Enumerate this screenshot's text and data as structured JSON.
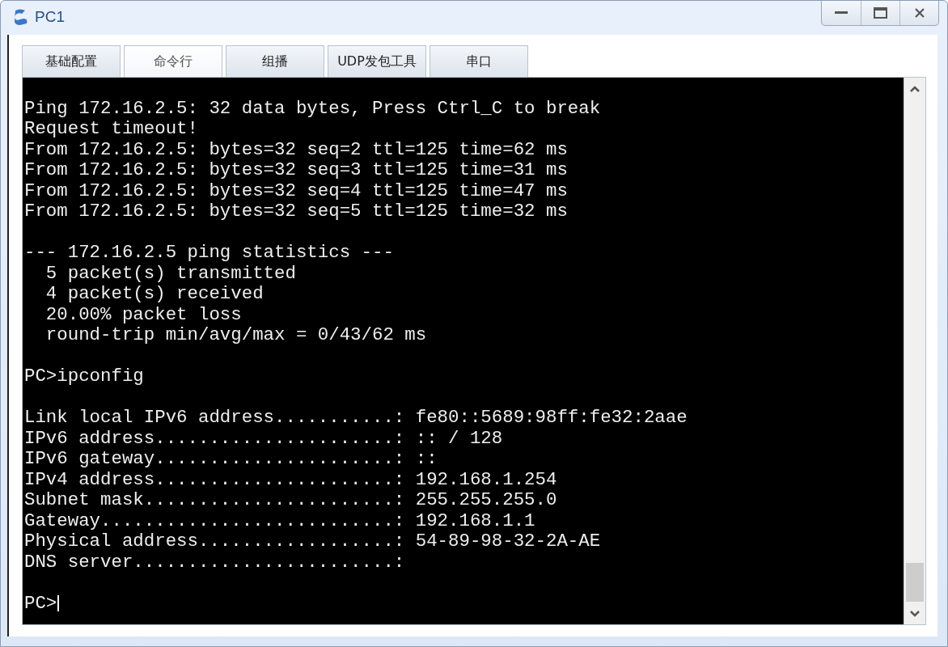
{
  "window": {
    "title": "PC1"
  },
  "tabs": [
    {
      "label": "基础配置",
      "selected": false
    },
    {
      "label": "命令行",
      "selected": true
    },
    {
      "label": "组播",
      "selected": false
    },
    {
      "label": "UDP发包工具",
      "selected": false
    },
    {
      "label": "串口",
      "selected": false
    }
  ],
  "terminal": {
    "lines": [
      {
        "kind": "blank"
      },
      {
        "kind": "text",
        "text": "Ping 172.16.2.5: 32 data bytes, Press Ctrl_C to break"
      },
      {
        "kind": "text",
        "text": "Request timeout!"
      },
      {
        "kind": "text",
        "text": "From 172.16.2.5: bytes=32 seq=2 ttl=125 time=62 ms"
      },
      {
        "kind": "text",
        "text": "From 172.16.2.5: bytes=32 seq=3 ttl=125 time=31 ms"
      },
      {
        "kind": "text",
        "text": "From 172.16.2.5: bytes=32 seq=4 ttl=125 time=47 ms"
      },
      {
        "kind": "text",
        "text": "From 172.16.2.5: bytes=32 seq=5 ttl=125 time=32 ms"
      },
      {
        "kind": "blank"
      },
      {
        "kind": "text",
        "text": "--- 172.16.2.5 ping statistics ---"
      },
      {
        "kind": "text",
        "text": "  5 packet(s) transmitted"
      },
      {
        "kind": "text",
        "text": "  4 packet(s) received"
      },
      {
        "kind": "text",
        "text": "  20.00% packet loss"
      },
      {
        "kind": "text",
        "text": "  round-trip min/avg/max = 0/43/62 ms"
      },
      {
        "kind": "blank"
      },
      {
        "kind": "text",
        "text": "PC>ipconfig"
      },
      {
        "kind": "blank"
      },
      {
        "kind": "text",
        "text": "Link local IPv6 address...........: fe80::5689:98ff:fe32:2aae"
      },
      {
        "kind": "text",
        "text": "IPv6 address......................: :: / 128"
      },
      {
        "kind": "text",
        "text": "IPv6 gateway......................: ::"
      },
      {
        "kind": "text",
        "text": "IPv4 address......................: 192.168.1.254"
      },
      {
        "kind": "text",
        "text": "Subnet mask.......................: 255.255.255.0"
      },
      {
        "kind": "text",
        "text": "Gateway...........................: 192.168.1.1"
      },
      {
        "kind": "text",
        "text": "Physical address..................: 54-89-98-32-2A-AE"
      },
      {
        "kind": "text",
        "text": "DNS server........................:"
      },
      {
        "kind": "blank"
      },
      {
        "kind": "prompt",
        "text": "PC>"
      }
    ]
  }
}
